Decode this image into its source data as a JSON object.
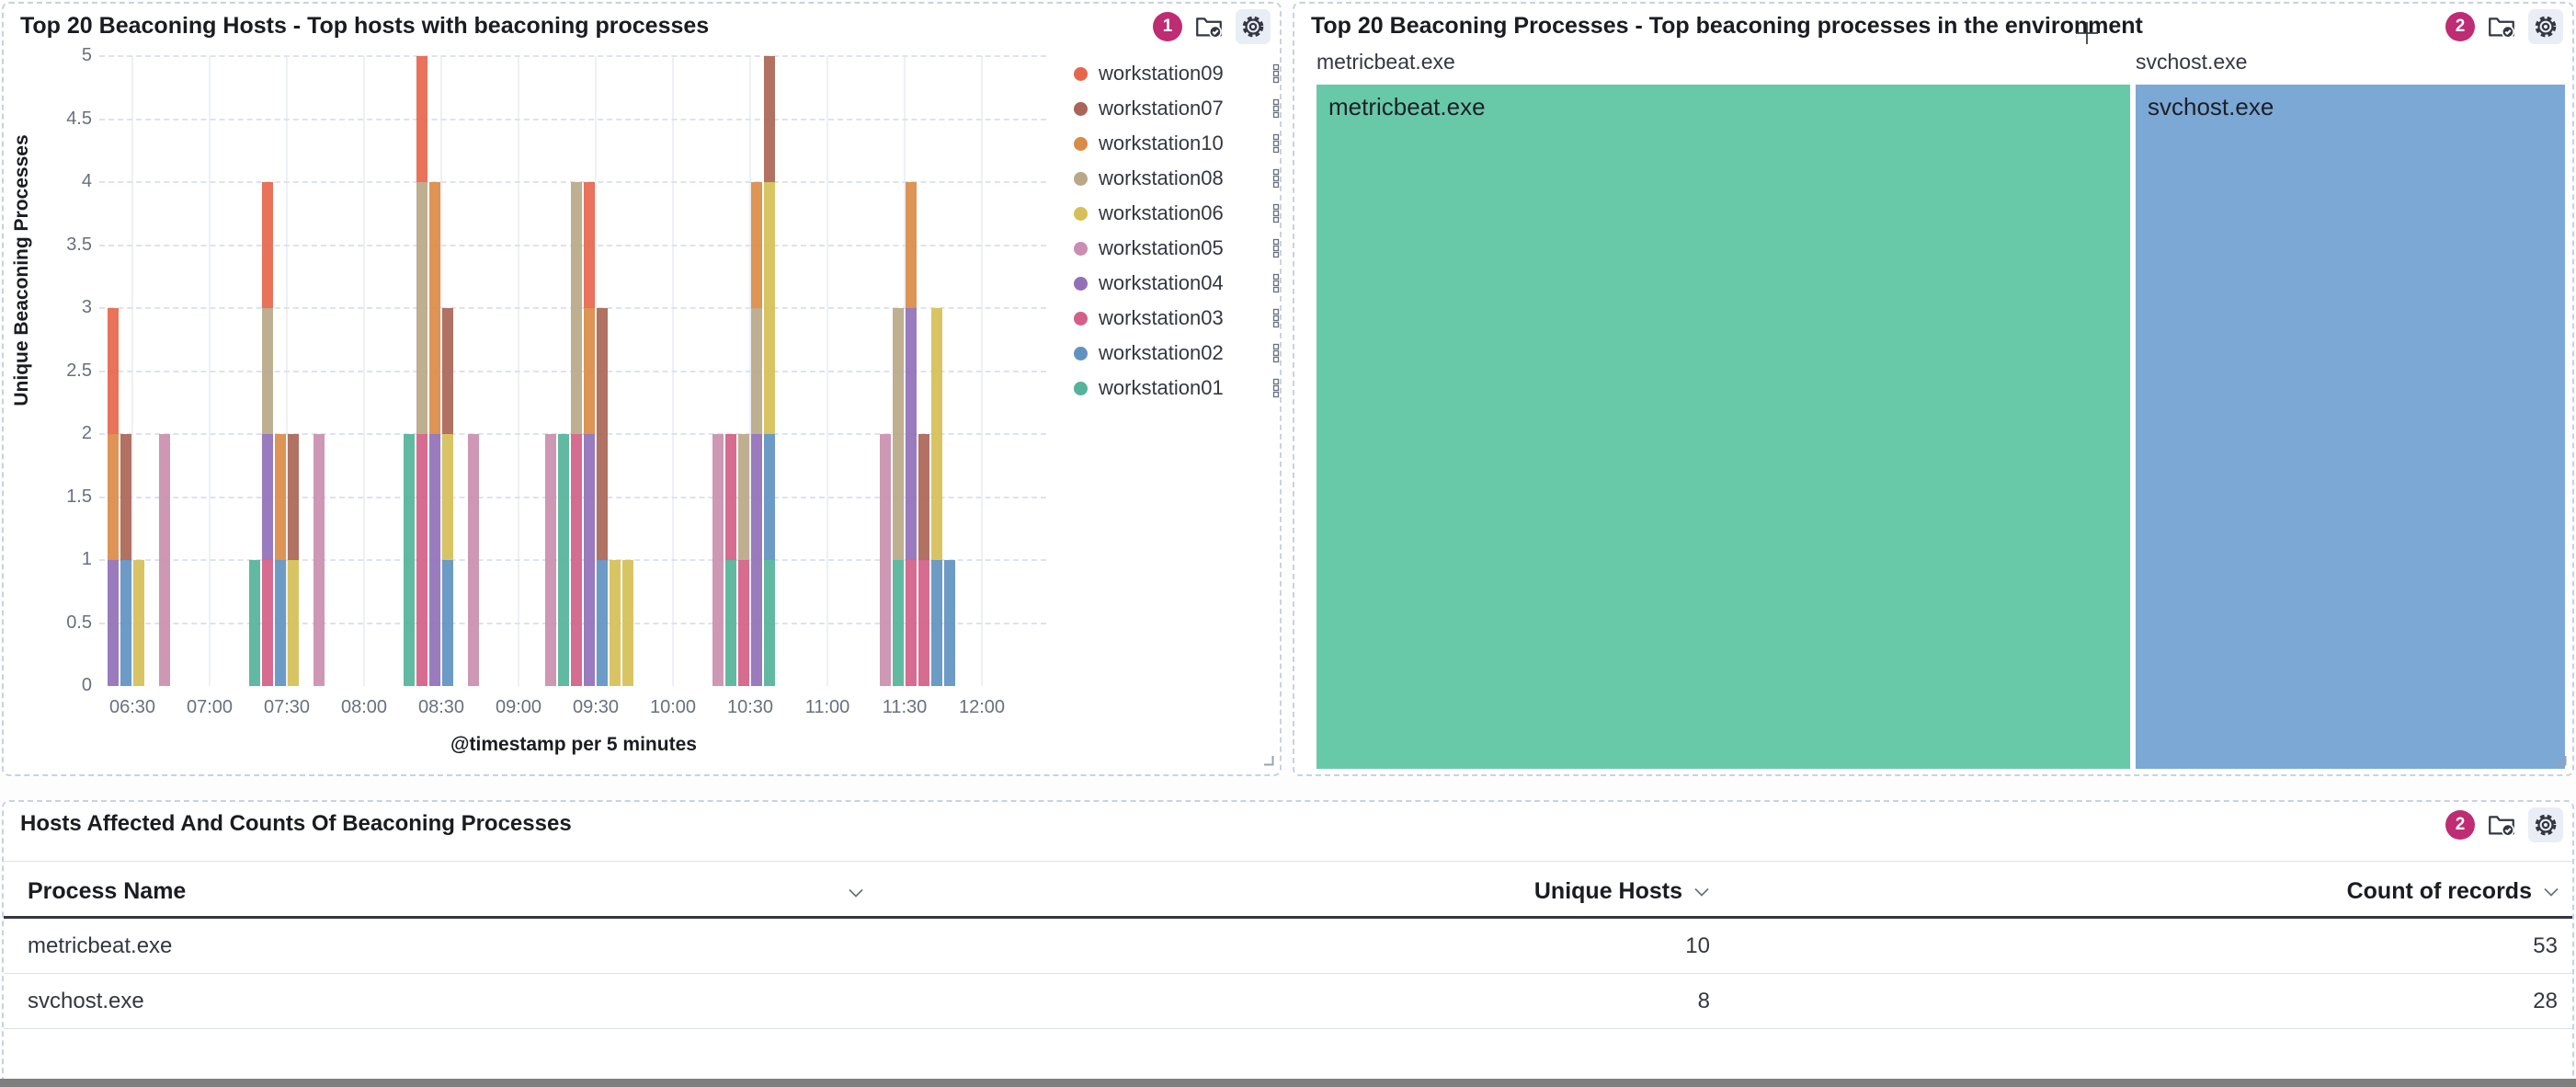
{
  "panels": {
    "hosts_chart": {
      "badge": "1"
    },
    "treemap": {
      "badge": "2"
    },
    "table": {
      "badge": "2"
    }
  },
  "chart_data": [
    {
      "type": "bar",
      "stacked": true,
      "title": "Top 20 Beaconing Hosts - Top hosts with beaconing processes",
      "xlabel": "@timestamp per 5 minutes",
      "ylabel": "Unique Beaconing Processes",
      "ylim": [
        0,
        5
      ],
      "y_ticks": [
        "0",
        "0.5",
        "1",
        "1.5",
        "2",
        "2.5",
        "3",
        "3.5",
        "4",
        "4.5",
        "5"
      ],
      "x_ticks": [
        "06:30",
        "07:00",
        "07:30",
        "08:00",
        "08:30",
        "09:00",
        "09:30",
        "10:00",
        "10:30",
        "11:00",
        "11:30",
        "12:00"
      ],
      "grid": {
        "horizontal": "dashed",
        "vertical": "solid"
      },
      "legend_position": "right",
      "legend": [
        "workstation09",
        "workstation07",
        "workstation10",
        "workstation08",
        "workstation06",
        "workstation05",
        "workstation04",
        "workstation03",
        "workstation02",
        "workstation01"
      ],
      "colors": {
        "workstation01": "#54B399",
        "workstation02": "#6092C0",
        "workstation03": "#D36086",
        "workstation04": "#9170B8",
        "workstation05": "#CA8EAE",
        "workstation06": "#D6BF57",
        "workstation07": "#AA6556",
        "workstation08": "#B9A888",
        "workstation09": "#E7664C",
        "workstation10": "#DA8B45"
      },
      "bars": [
        {
          "time": "06:20",
          "segments": [
            [
              "workstation04",
              1
            ],
            [
              "workstation10",
              1
            ],
            [
              "workstation09",
              1
            ]
          ]
        },
        {
          "time": "06:25",
          "segments": [
            [
              "workstation02",
              1
            ],
            [
              "workstation07",
              1
            ]
          ]
        },
        {
          "time": "06:30",
          "segments": [
            [
              "workstation06",
              1
            ]
          ]
        },
        {
          "time": "06:40",
          "segments": [
            [
              "workstation05",
              2
            ]
          ]
        },
        {
          "time": "07:15",
          "segments": [
            [
              "workstation01",
              1
            ]
          ]
        },
        {
          "time": "07:20",
          "segments": [
            [
              "workstation03",
              1
            ],
            [
              "workstation04",
              1
            ],
            [
              "workstation08",
              1
            ],
            [
              "workstation09",
              1
            ]
          ]
        },
        {
          "time": "07:25",
          "segments": [
            [
              "workstation02",
              1
            ],
            [
              "workstation10",
              1
            ]
          ]
        },
        {
          "time": "07:30",
          "segments": [
            [
              "workstation06",
              1
            ],
            [
              "workstation07",
              1
            ]
          ]
        },
        {
          "time": "07:40",
          "segments": [
            [
              "workstation05",
              2
            ]
          ]
        },
        {
          "time": "08:15",
          "segments": [
            [
              "workstation01",
              2
            ]
          ]
        },
        {
          "time": "08:20",
          "segments": [
            [
              "workstation03",
              2
            ],
            [
              "workstation08",
              2
            ],
            [
              "workstation09",
              1
            ]
          ]
        },
        {
          "time": "08:25",
          "segments": [
            [
              "workstation04",
              2
            ],
            [
              "workstation10",
              2
            ]
          ]
        },
        {
          "time": "08:30",
          "segments": [
            [
              "workstation02",
              1
            ],
            [
              "workstation06",
              1
            ],
            [
              "workstation07",
              1
            ]
          ]
        },
        {
          "time": "08:40",
          "segments": [
            [
              "workstation05",
              2
            ]
          ]
        },
        {
          "time": "09:10",
          "segments": [
            [
              "workstation05",
              2
            ]
          ]
        },
        {
          "time": "09:15",
          "segments": [
            [
              "workstation01",
              2
            ]
          ]
        },
        {
          "time": "09:20",
          "segments": [
            [
              "workstation03",
              2
            ],
            [
              "workstation08",
              2
            ]
          ]
        },
        {
          "time": "09:25",
          "segments": [
            [
              "workstation04",
              2
            ],
            [
              "workstation10",
              1
            ],
            [
              "workstation09",
              1
            ]
          ]
        },
        {
          "time": "09:30",
          "segments": [
            [
              "workstation02",
              1
            ],
            [
              "workstation07",
              2
            ]
          ]
        },
        {
          "time": "09:35",
          "segments": [
            [
              "workstation06",
              1
            ]
          ]
        },
        {
          "time": "09:40",
          "segments": [
            [
              "workstation06",
              1
            ]
          ]
        },
        {
          "time": "10:15",
          "segments": [
            [
              "workstation05",
              2
            ]
          ]
        },
        {
          "time": "10:20",
          "segments": [
            [
              "workstation01",
              1
            ],
            [
              "workstation03",
              1
            ]
          ]
        },
        {
          "time": "10:25",
          "segments": [
            [
              "workstation03",
              1
            ],
            [
              "workstation08",
              1
            ]
          ]
        },
        {
          "time": "10:30",
          "segments": [
            [
              "workstation04",
              2
            ],
            [
              "workstation08",
              1
            ],
            [
              "workstation10",
              1
            ]
          ]
        },
        {
          "time": "10:35",
          "segments": [
            [
              "workstation01",
              1
            ],
            [
              "workstation02",
              1
            ],
            [
              "workstation06",
              2
            ],
            [
              "workstation07",
              1
            ]
          ]
        },
        {
          "time": "11:20",
          "segments": [
            [
              "workstation05",
              2
            ]
          ]
        },
        {
          "time": "11:25",
          "segments": [
            [
              "workstation01",
              1
            ],
            [
              "workstation08",
              2
            ]
          ]
        },
        {
          "time": "11:30",
          "segments": [
            [
              "workstation03",
              1
            ],
            [
              "workstation04",
              2
            ],
            [
              "workstation10",
              1
            ]
          ]
        },
        {
          "time": "11:35",
          "segments": [
            [
              "workstation03",
              1
            ],
            [
              "workstation07",
              1
            ]
          ]
        },
        {
          "time": "11:40",
          "segments": [
            [
              "workstation02",
              1
            ],
            [
              "workstation06",
              2
            ]
          ]
        },
        {
          "time": "11:45",
          "segments": [
            [
              "workstation02",
              1
            ]
          ]
        }
      ]
    },
    {
      "type": "treemap",
      "title": "Top 20 Beaconing Processes - Top beaconing processes in the environment",
      "tiles": [
        {
          "label": "metricbeat.exe",
          "value": 53,
          "color": "#68C9A9"
        },
        {
          "label": "svchost.exe",
          "value": 28,
          "color": "#7CA8D6"
        }
      ]
    },
    {
      "type": "table",
      "title": "Hosts Affected And Counts Of Beaconing Processes",
      "columns": [
        "Process Name",
        "Unique Hosts",
        "Count of records"
      ],
      "rows": [
        {
          "process": "metricbeat.exe",
          "unique_hosts": "10",
          "count_of_records": "53"
        },
        {
          "process": "svchost.exe",
          "unique_hosts": "8",
          "count_of_records": "28"
        }
      ]
    }
  ]
}
